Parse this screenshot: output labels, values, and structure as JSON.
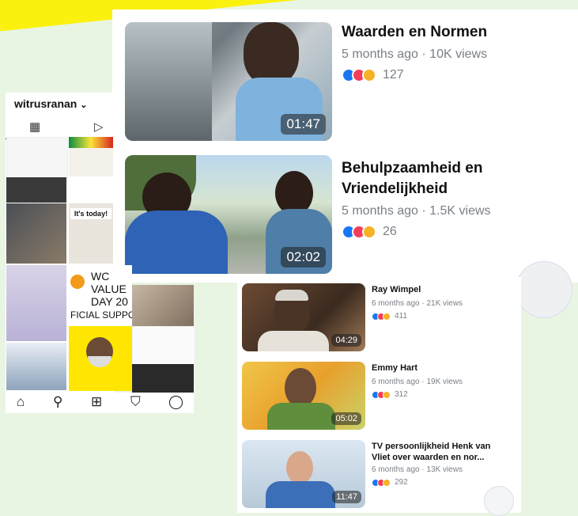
{
  "instagram": {
    "username": "witrusranan",
    "chevron": "⌄",
    "grid_icon": "grid-icon",
    "reels_icon": "reels-icon",
    "tiles": {
      "its_today": "It's today!",
      "wc_line1": "WC",
      "wc_line2": "VALUE",
      "wc_line3": "DAY 20",
      "wc_line4": "FICIAL SUPPORT"
    },
    "nav": {
      "home": "home-icon",
      "search": "search-icon",
      "add": "add-icon",
      "shop": "shop-icon",
      "profile": "profile-icon"
    }
  },
  "videos_large": [
    {
      "title_line1": "Waarden en Normen",
      "title_line2": "",
      "meta": "5 months ago · 10K views",
      "reactions": "127",
      "duration": "01:47"
    },
    {
      "title_line1": "Behulpzaamheid en",
      "title_line2": "Vriendelijkheid",
      "meta": "5 months ago · 1.5K views",
      "reactions": "26",
      "duration": "02:02"
    }
  ],
  "videos_small": [
    {
      "title_line1": "Ray Wimpel",
      "title_line2": "",
      "meta": "6 months ago · 21K views",
      "reactions": "411",
      "duration": "04:29"
    },
    {
      "title_line1": "Emmy Hart",
      "title_line2": "",
      "meta": "6 months ago · 19K views",
      "reactions": "312",
      "duration": "05:02"
    },
    {
      "title_line1": "TV persoonlijkheid Henk van",
      "title_line2": "Vliet over waarden en nor...",
      "meta": "6 months ago · 13K views",
      "reactions": "292",
      "duration": "11:47"
    }
  ],
  "colors": {
    "like": "#1877f2",
    "love": "#f33e58",
    "haha": "#f7b125",
    "yellow": "#fbf10f"
  }
}
